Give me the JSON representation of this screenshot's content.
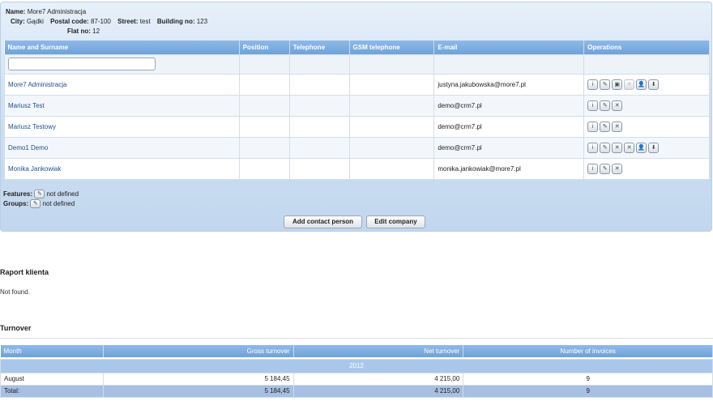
{
  "company": {
    "name_label": "Name:",
    "name": "More7 Administracja",
    "city_label": "City:",
    "city": "Gądki",
    "postal_label": "Postal code:",
    "postal": "87-100",
    "street_label": "Street:",
    "street": "test",
    "building_label": "Building no:",
    "building": "123",
    "flat_label": "Flat no:",
    "flat": "12"
  },
  "contacts": {
    "headers": [
      "Name and Surname",
      "Position",
      "Telephone",
      "GSM telephone",
      "E-mail",
      "Operations"
    ],
    "filter_placeholder": "",
    "rows": [
      {
        "name": "More7 Administracja",
        "position": "",
        "phone": "",
        "gsm": "",
        "email": "justyna.jakubowska@more7.pl",
        "ops": [
          "info",
          "edit",
          "group",
          "delete-disabled",
          "user",
          "download"
        ]
      },
      {
        "name": "Mariusz Test",
        "position": "",
        "phone": "",
        "gsm": "",
        "email": "demo@crm7.pl",
        "ops": [
          "info",
          "edit",
          "delete"
        ]
      },
      {
        "name": "Mariusz Testowy",
        "position": "",
        "phone": "",
        "gsm": "",
        "email": "demo@crm7.pl",
        "ops": [
          "info",
          "edit",
          "delete"
        ]
      },
      {
        "name": "Demo1 Demo",
        "position": "",
        "phone": "",
        "gsm": "",
        "email": "demo@crm7.pl",
        "ops": [
          "info",
          "edit",
          "delete",
          "delete",
          "user",
          "download"
        ]
      },
      {
        "name": "Monika Jankowiak",
        "position": "",
        "phone": "",
        "gsm": "",
        "email": "monika.jankowiak@more7.pl",
        "ops": [
          "info",
          "edit",
          "delete"
        ]
      }
    ]
  },
  "features": {
    "features_label": "Features:",
    "features_value": "not defined",
    "groups_label": "Groups:",
    "groups_value": "not defined"
  },
  "buttons": {
    "add_contact": "Add contact person",
    "edit_company": "Edit company"
  },
  "report": {
    "title": "Raport klienta",
    "empty": "Not found."
  },
  "turnover": {
    "title": "Turnover",
    "headers": [
      "Month",
      "Gross turnover",
      "Net turnover",
      "Number of invoices"
    ],
    "year": "2012",
    "rows": [
      {
        "month": "August",
        "gross": "5 184,45",
        "net": "4 215,00",
        "invoices": "9"
      }
    ],
    "total": {
      "label": "Total:",
      "gross": "5 184,45",
      "net": "4 215,00",
      "invoices": "9"
    }
  },
  "icons": {
    "info": "i",
    "edit": "✎",
    "group": "▣",
    "delete": "✕",
    "delete-disabled": "✕",
    "user": "👤",
    "download": "⬇"
  }
}
